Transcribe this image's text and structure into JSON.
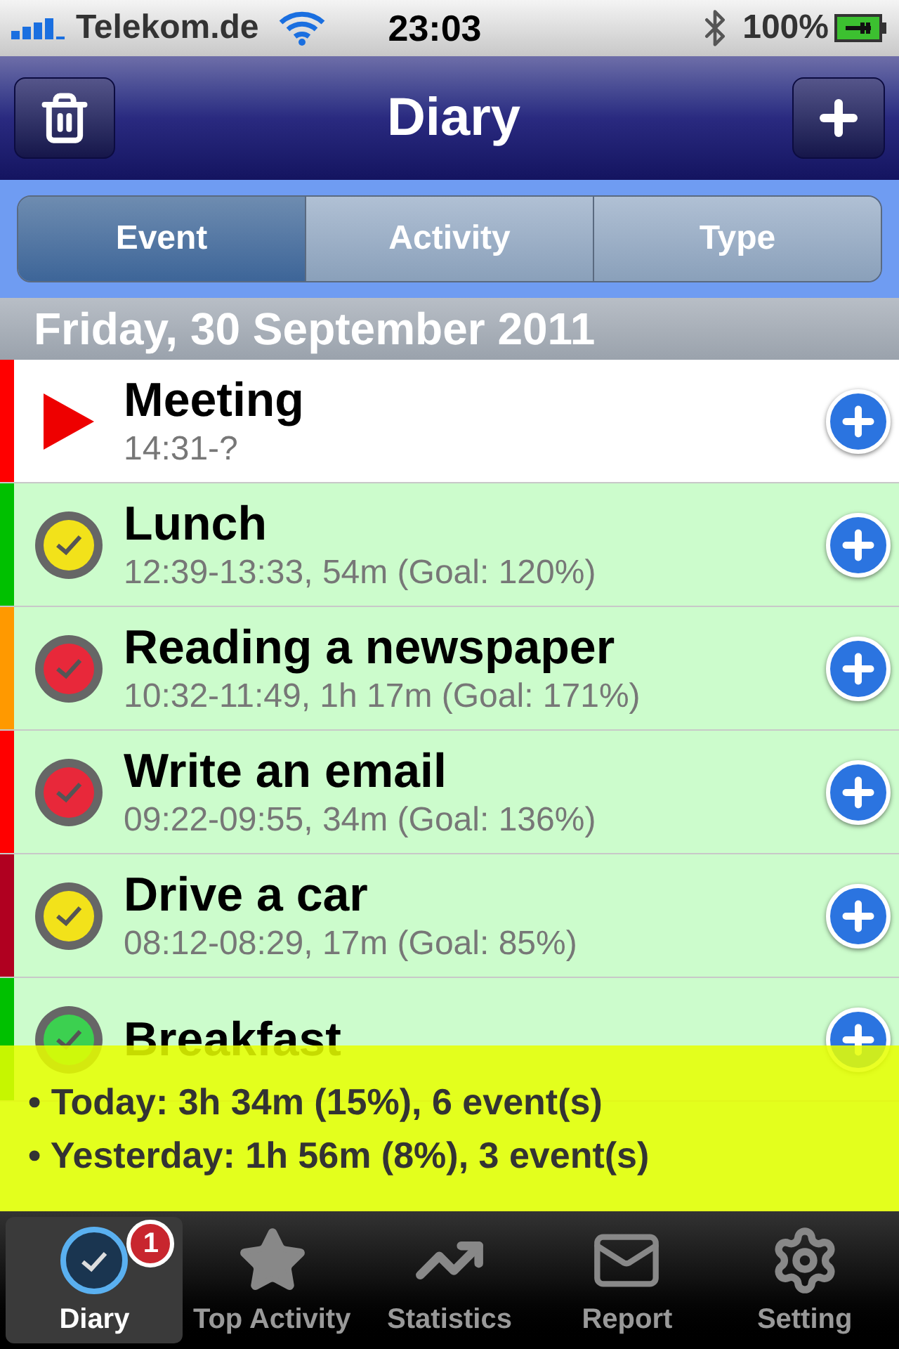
{
  "status_bar": {
    "carrier": "Telekom.de",
    "time": "23:03",
    "battery": "100%"
  },
  "nav_bar": {
    "title": "Diary"
  },
  "segments": [
    {
      "label": "Event",
      "selected": true
    },
    {
      "label": "Activity",
      "selected": false
    },
    {
      "label": "Type",
      "selected": false
    }
  ],
  "sections": [
    {
      "header": "Friday, 30 September 2011",
      "events": [
        {
          "kind": "running",
          "title": "Meeting",
          "detail": "14:31-?",
          "color": "#ff0000"
        },
        {
          "kind": "yellow",
          "title": "Lunch",
          "detail": "12:39-13:33, 54m (Goal: 120%)",
          "color": "#00c000"
        },
        {
          "kind": "red",
          "title": "Reading a newspaper",
          "detail": "10:32-11:49, 1h 17m (Goal: 171%)",
          "color": "#ff9900"
        },
        {
          "kind": "red",
          "title": "Write an email",
          "detail": "09:22-09:55, 34m (Goal: 136%)",
          "color": "#ff0000"
        },
        {
          "kind": "yellow",
          "title": "Drive a car",
          "detail": "08:12-08:29, 17m (Goal: 85%)",
          "color": "#b00020"
        },
        {
          "kind": "green",
          "title": "Breakfast",
          "color": "#00c000"
        }
      ]
    }
  ],
  "summary": [
    "• Today: 3h 34m (15%), 6 event(s)",
    "• Yesterday: 1h 56m (8%), 3 event(s)"
  ],
  "tab_bar": [
    {
      "label": "Diary",
      "selected": true,
      "badge": "1"
    },
    {
      "label": "Top Activity",
      "selected": false
    },
    {
      "label": "Statistics",
      "selected": false
    },
    {
      "label": "Report",
      "selected": false
    },
    {
      "label": "Setting",
      "selected": false
    }
  ]
}
